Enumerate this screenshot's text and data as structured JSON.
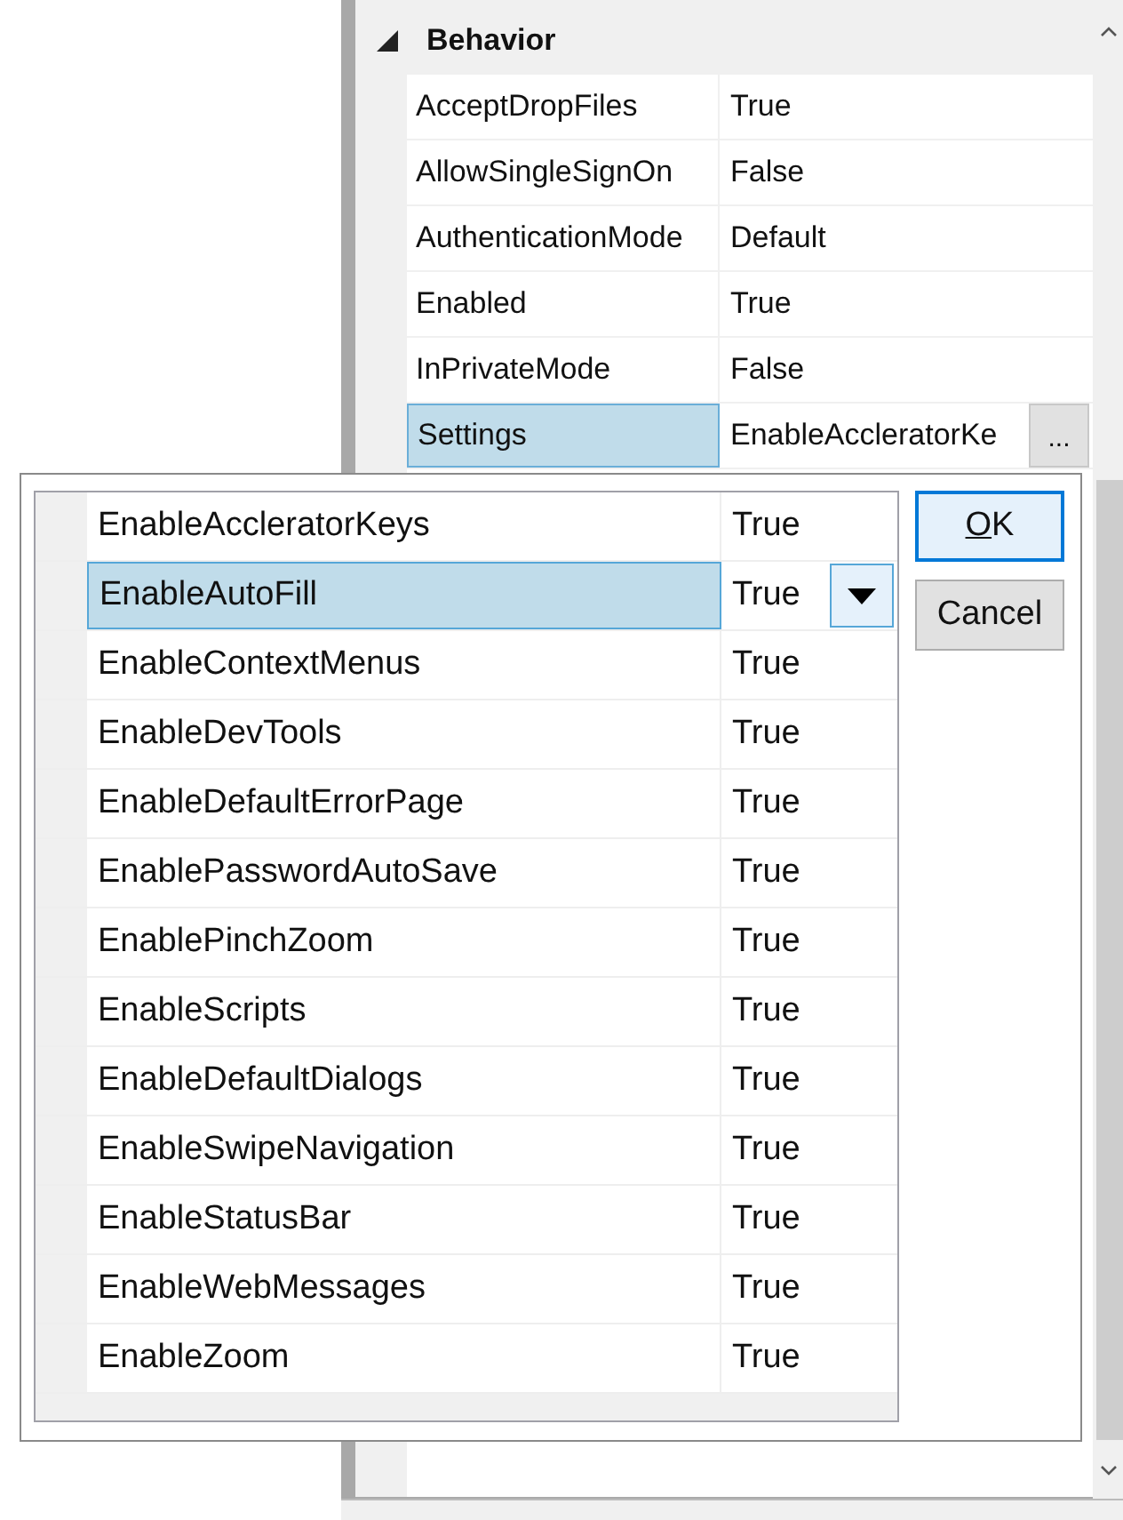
{
  "property_grid": {
    "category": {
      "label": "Behavior",
      "expanded": true
    },
    "properties": [
      {
        "name": "AcceptDropFiles",
        "value": "True",
        "selected": false
      },
      {
        "name": "AllowSingleSignOn",
        "value": "False",
        "selected": false
      },
      {
        "name": "AuthenticationMode",
        "value": "Default",
        "selected": false
      },
      {
        "name": "Enabled",
        "value": "True",
        "selected": false
      },
      {
        "name": "InPrivateMode",
        "value": "False",
        "selected": false
      },
      {
        "name": "Settings",
        "value": "EnableAccleratorKe",
        "selected": true,
        "button": "..."
      }
    ]
  },
  "dialog": {
    "items": [
      {
        "name": "EnableAccleratorKeys",
        "value": "True",
        "selected": false
      },
      {
        "name": "EnableAutoFill",
        "value": "True",
        "selected": true
      },
      {
        "name": "EnableContextMenus",
        "value": "True",
        "selected": false
      },
      {
        "name": "EnableDevTools",
        "value": "True",
        "selected": false
      },
      {
        "name": "EnableDefaultErrorPage",
        "value": "True",
        "selected": false
      },
      {
        "name": "EnablePasswordAutoSave",
        "value": "True",
        "selected": false
      },
      {
        "name": "EnablePinchZoom",
        "value": "True",
        "selected": false
      },
      {
        "name": "EnableScripts",
        "value": "True",
        "selected": false
      },
      {
        "name": "EnableDefaultDialogs",
        "value": "True",
        "selected": false
      },
      {
        "name": "EnableSwipeNavigation",
        "value": "True",
        "selected": false
      },
      {
        "name": "EnableStatusBar",
        "value": "True",
        "selected": false
      },
      {
        "name": "EnableWebMessages",
        "value": "True",
        "selected": false
      },
      {
        "name": "EnableZoom",
        "value": "True",
        "selected": false
      }
    ],
    "buttons": [
      {
        "label": "OK",
        "default": true,
        "underline_first": true
      },
      {
        "label": "Cancel",
        "default": false,
        "underline_first": false
      }
    ]
  }
}
